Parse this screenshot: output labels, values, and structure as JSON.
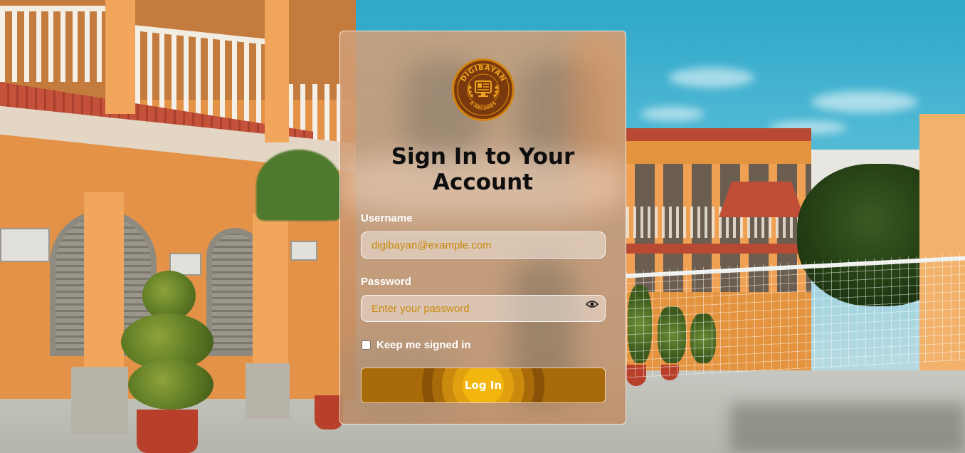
{
  "logo": {
    "brand_top": "DIGIBAYAN",
    "brand_bottom": "E-RECORDS"
  },
  "login_form": {
    "title_line1": "Sign In to Your",
    "title_line2": "Account",
    "username": {
      "label": "Username",
      "placeholder": "digibayan@example.com"
    },
    "password": {
      "label": "Password",
      "placeholder": "Enter your password",
      "toggle_icon": "eye-icon"
    },
    "remember": {
      "label": "Keep me signed in",
      "checked": false
    },
    "submit_label": "Log In"
  },
  "colors": {
    "accent": "#a96a09",
    "logo_bg": "#7b3a0e",
    "logo_ring": "#d4830f",
    "input_text": "#c98a0e"
  }
}
